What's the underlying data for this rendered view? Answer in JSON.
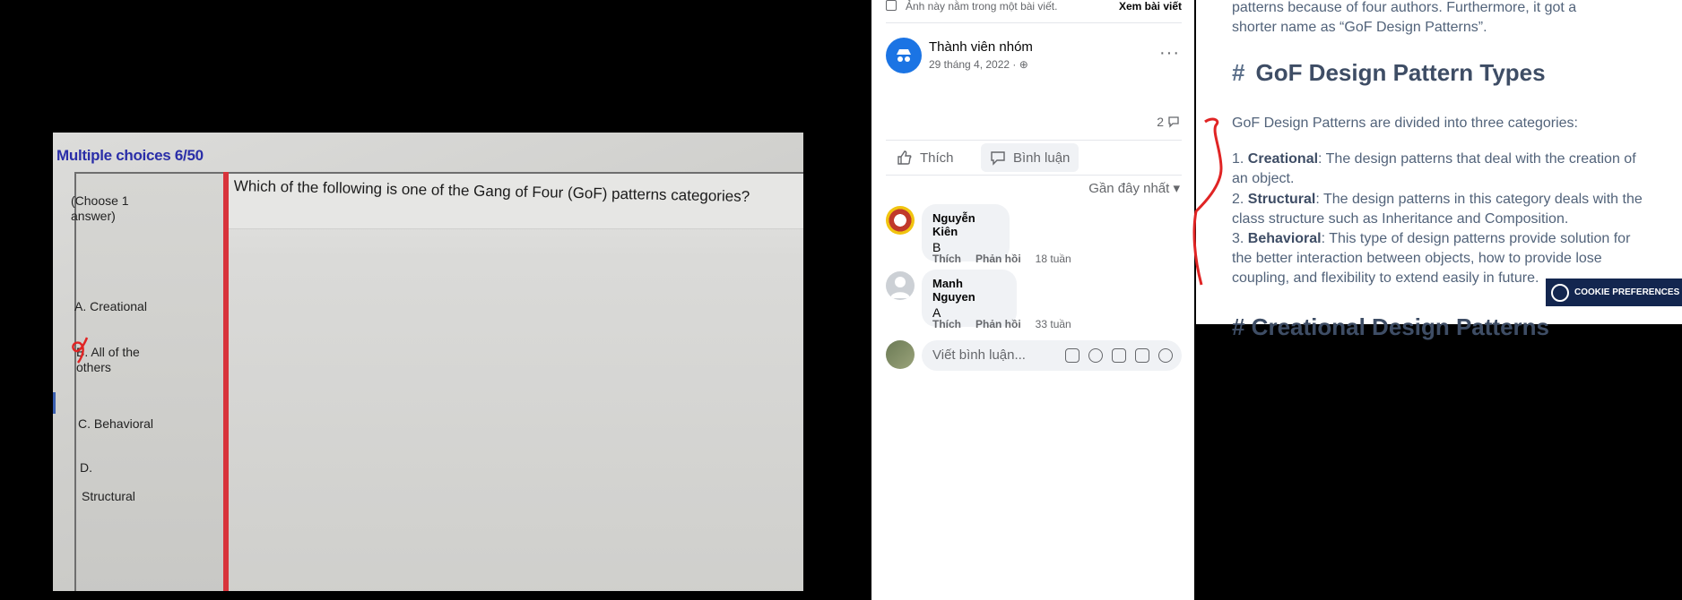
{
  "photo": {
    "title": "Multiple choices 6/50",
    "instruction": "(Choose 1 answer)",
    "question": "Which of the following is one of the Gang of Four (GoF) patterns categories?",
    "options": {
      "a": "A. Creational",
      "b": "B. All of the others",
      "c": "C. Behavioral",
      "d": "D.",
      "d_text": "Structural"
    }
  },
  "fb": {
    "top_note": "Ảnh này nằm trong một bài viết.",
    "view_post": "Xem bài viết",
    "poster": "Thành viên nhóm",
    "post_date": "29 tháng 4, 2022 · ",
    "more": "···",
    "comment_count": "2",
    "like": "Thích",
    "comment": "Bình luận",
    "sort": "Gần đây nhất ▾",
    "comments": [
      {
        "name": "Nguyễn Kiên",
        "text": "B",
        "like": "Thích",
        "reply": "Phản hồi",
        "time": "18 tuần"
      },
      {
        "name": "Manh Nguyen",
        "text": "A",
        "like": "Thích",
        "reply": "Phản hồi",
        "time": "33 tuần"
      }
    ],
    "write_placeholder": "Viết bình luận..."
  },
  "article": {
    "intro_1": "patterns because of four authors. Furthermore, it got a",
    "intro_2": "shorter name as “GoF Design Patterns”.",
    "heading_hash": "#",
    "heading": "GoF Design Pattern Types",
    "lead": "GoF Design Patterns are divided into three categories:",
    "items": [
      {
        "num": "1. ",
        "term": "Creational",
        "desc": ": The design patterns that deal with the creation of an object."
      },
      {
        "num": "2. ",
        "term": "Structural",
        "desc": ": The design patterns in this category deals with the class structure such as Inheritance and Composition."
      },
      {
        "num": "3. ",
        "term": "Behavioral",
        "desc": ": This type of design patterns provide solution for the better interaction between objects, how to provide lose coupling, and flexibility to extend easily in future."
      }
    ],
    "next_heading": "# Creational Design Patterns",
    "cookie": "COOKIE PREFERENCES"
  },
  "colors": {
    "fb_blue": "#1b74e4",
    "red_ink": "#e02424",
    "cookie_bg": "#13264f"
  }
}
